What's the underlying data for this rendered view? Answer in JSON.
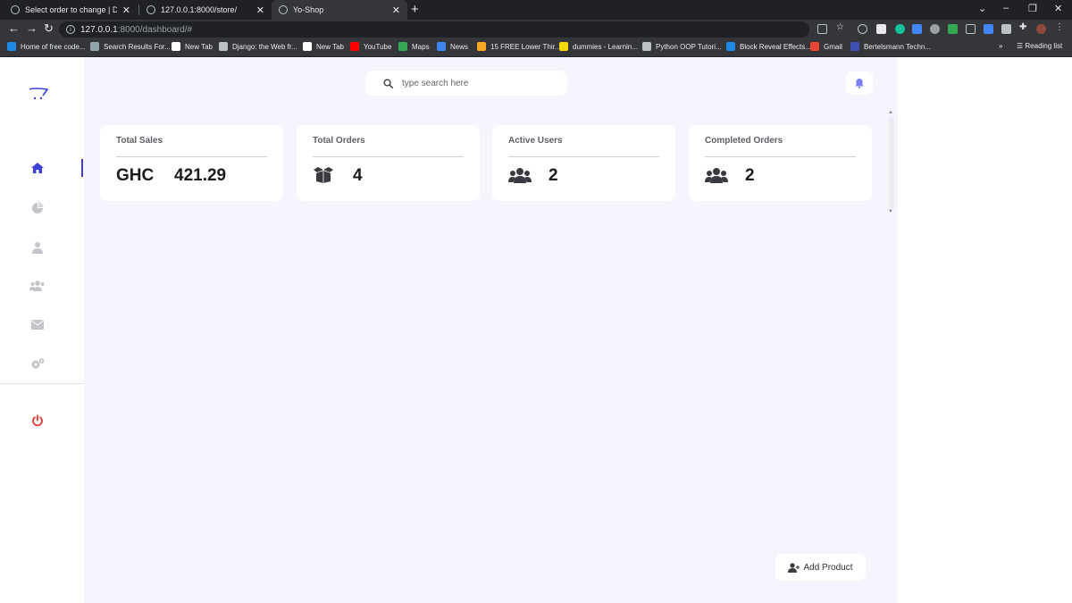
{
  "browser": {
    "tabs": [
      {
        "title": "Select order to change | Django site admin",
        "active": false
      },
      {
        "title": "127.0.0.1:8000/store/",
        "active": false
      },
      {
        "title": "Yo-Shop",
        "active": true
      }
    ],
    "url_host": "127.0.0.1",
    "url_path": ":8000/dashboard/#",
    "bookmarks": [
      {
        "label": "Home of free code...",
        "color": "#1e88e5"
      },
      {
        "label": "Search Results For...",
        "color": "#90a4ae"
      },
      {
        "label": "New Tab",
        "color": "#ffffff"
      },
      {
        "label": "Django: the Web fr...",
        "color": "#bdc1c6"
      },
      {
        "label": "New Tab",
        "color": "#ffffff"
      },
      {
        "label": "YouTube",
        "color": "#ff0000"
      },
      {
        "label": "Maps",
        "color": "#34a853"
      },
      {
        "label": "News",
        "color": "#4285f4"
      },
      {
        "label": "15 FREE Lower Thir...",
        "color": "#f9a825"
      },
      {
        "label": "dummies - Learnin...",
        "color": "#f5d90a"
      },
      {
        "label": "Python OOP Tutori...",
        "color": "#bdc1c6"
      },
      {
        "label": "Block Reveal Effects...",
        "color": "#1e88e5"
      },
      {
        "label": "Gmail",
        "color": "#ea4335"
      },
      {
        "label": "Bertelsmann Techn...",
        "color": "#3f51b5"
      }
    ],
    "reading_list": "Reading list",
    "overflow": "»"
  },
  "search": {
    "placeholder": "type search here"
  },
  "cards": [
    {
      "title": "Total Sales",
      "prefix": "GHC",
      "value": "421.29",
      "icon": "currency"
    },
    {
      "title": "Total Orders",
      "value": "4",
      "icon": "box-icon"
    },
    {
      "title": "Active Users",
      "value": "2",
      "icon": "users-icon"
    },
    {
      "title": "Completed Orders",
      "value": "2",
      "icon": "users-icon"
    }
  ],
  "add_product": {
    "label": "Add Product"
  },
  "colors": {
    "accent": "#3c40d8",
    "logout": "#e53935",
    "main_bg": "#f5f6fd",
    "bell": "#7c7ef5"
  }
}
